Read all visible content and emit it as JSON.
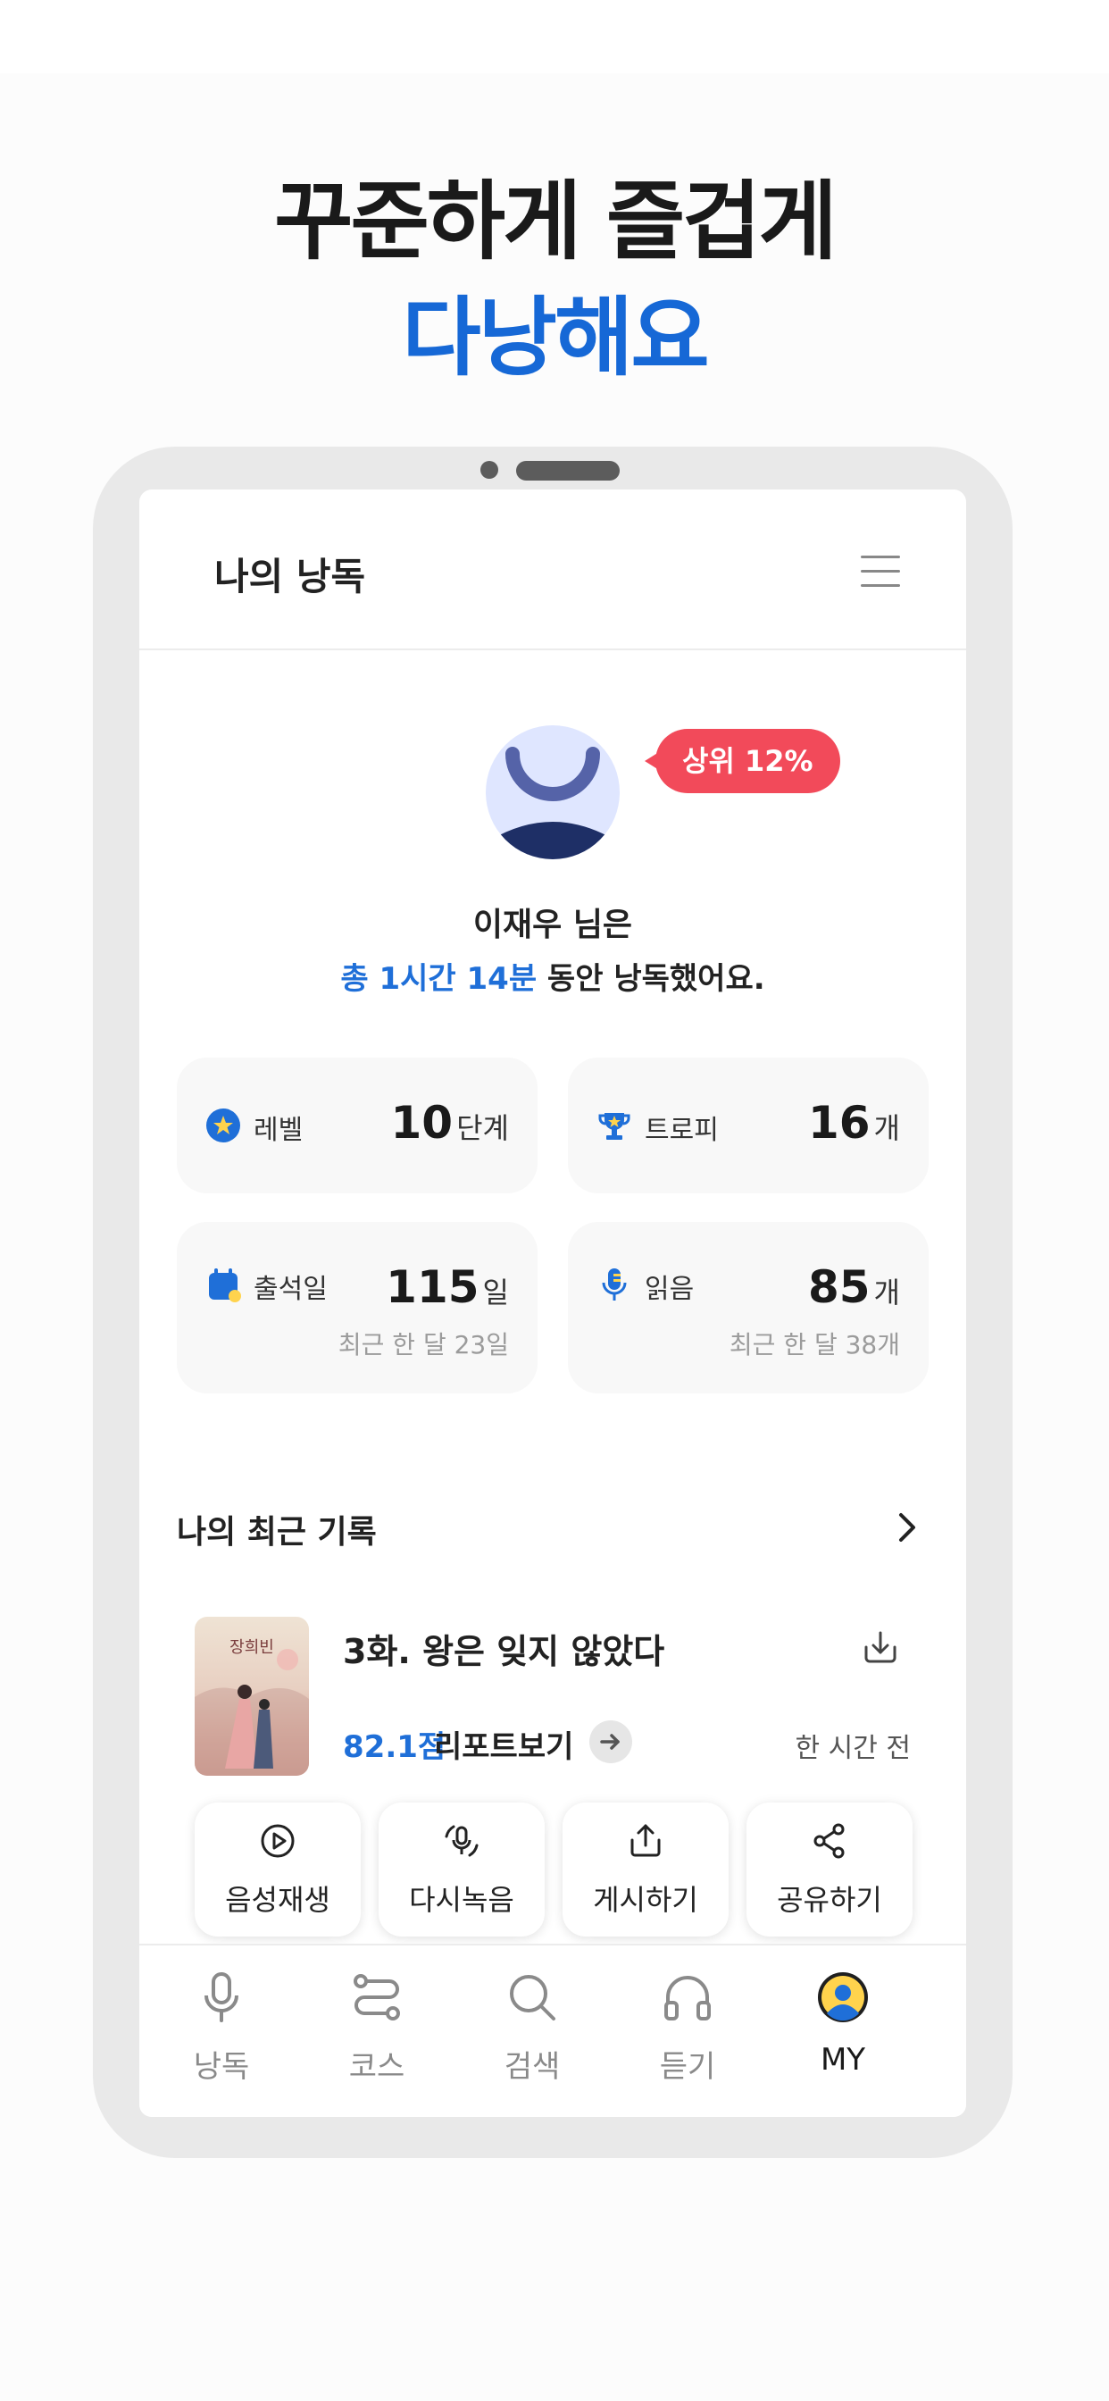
{
  "promo": {
    "line1": "꾸준하게 즐겁게",
    "line2": "다낭해요"
  },
  "app": {
    "title": "나의 낭독",
    "menu_icon": "hamburger-menu-icon"
  },
  "profile": {
    "rank_badge": "상위 12%",
    "name_line": "이재우 님은",
    "time_highlight": "총 1시간 14분",
    "time_rest": " 동안 낭독했어요."
  },
  "stats": [
    {
      "icon": "star-badge-icon",
      "label": "레벨",
      "value": "10",
      "unit": "단계"
    },
    {
      "icon": "trophy-icon",
      "label": "트로피",
      "value": "16",
      "unit": "개"
    },
    {
      "icon": "calendar-icon",
      "label": "출석일",
      "value": "115",
      "unit": "일",
      "sub": "최근 한 달 23일"
    },
    {
      "icon": "microphone-icon",
      "label": "읽음",
      "value": "85",
      "unit": "개",
      "sub": "최근 한 달 38개"
    }
  ],
  "recent": {
    "section_title": "나의 최근 기록",
    "cover_text": "장희빈",
    "record_title": "3화. 왕은 잊지 않았다",
    "score": "82.1점",
    "report_label": "리포트보기",
    "time": "한 시간 전"
  },
  "actions": [
    {
      "icon": "play-circle-icon",
      "label": "음성재생"
    },
    {
      "icon": "re-record-icon",
      "label": "다시녹음"
    },
    {
      "icon": "share-upload-icon",
      "label": "게시하기"
    },
    {
      "icon": "share-icon",
      "label": "공유하기"
    }
  ],
  "tabs": [
    {
      "icon": "microphone-icon",
      "label": "낭독",
      "active": false
    },
    {
      "icon": "course-icon",
      "label": "코스",
      "active": false
    },
    {
      "icon": "search-icon",
      "label": "검색",
      "active": false
    },
    {
      "icon": "headphones-icon",
      "label": "듣기",
      "active": false
    },
    {
      "icon": "profile-icon",
      "label": "MY",
      "active": true
    }
  ],
  "colors": {
    "accent_blue": "#1f6fd8",
    "badge_red": "#f24a5a",
    "navy": "#1e2f66"
  }
}
